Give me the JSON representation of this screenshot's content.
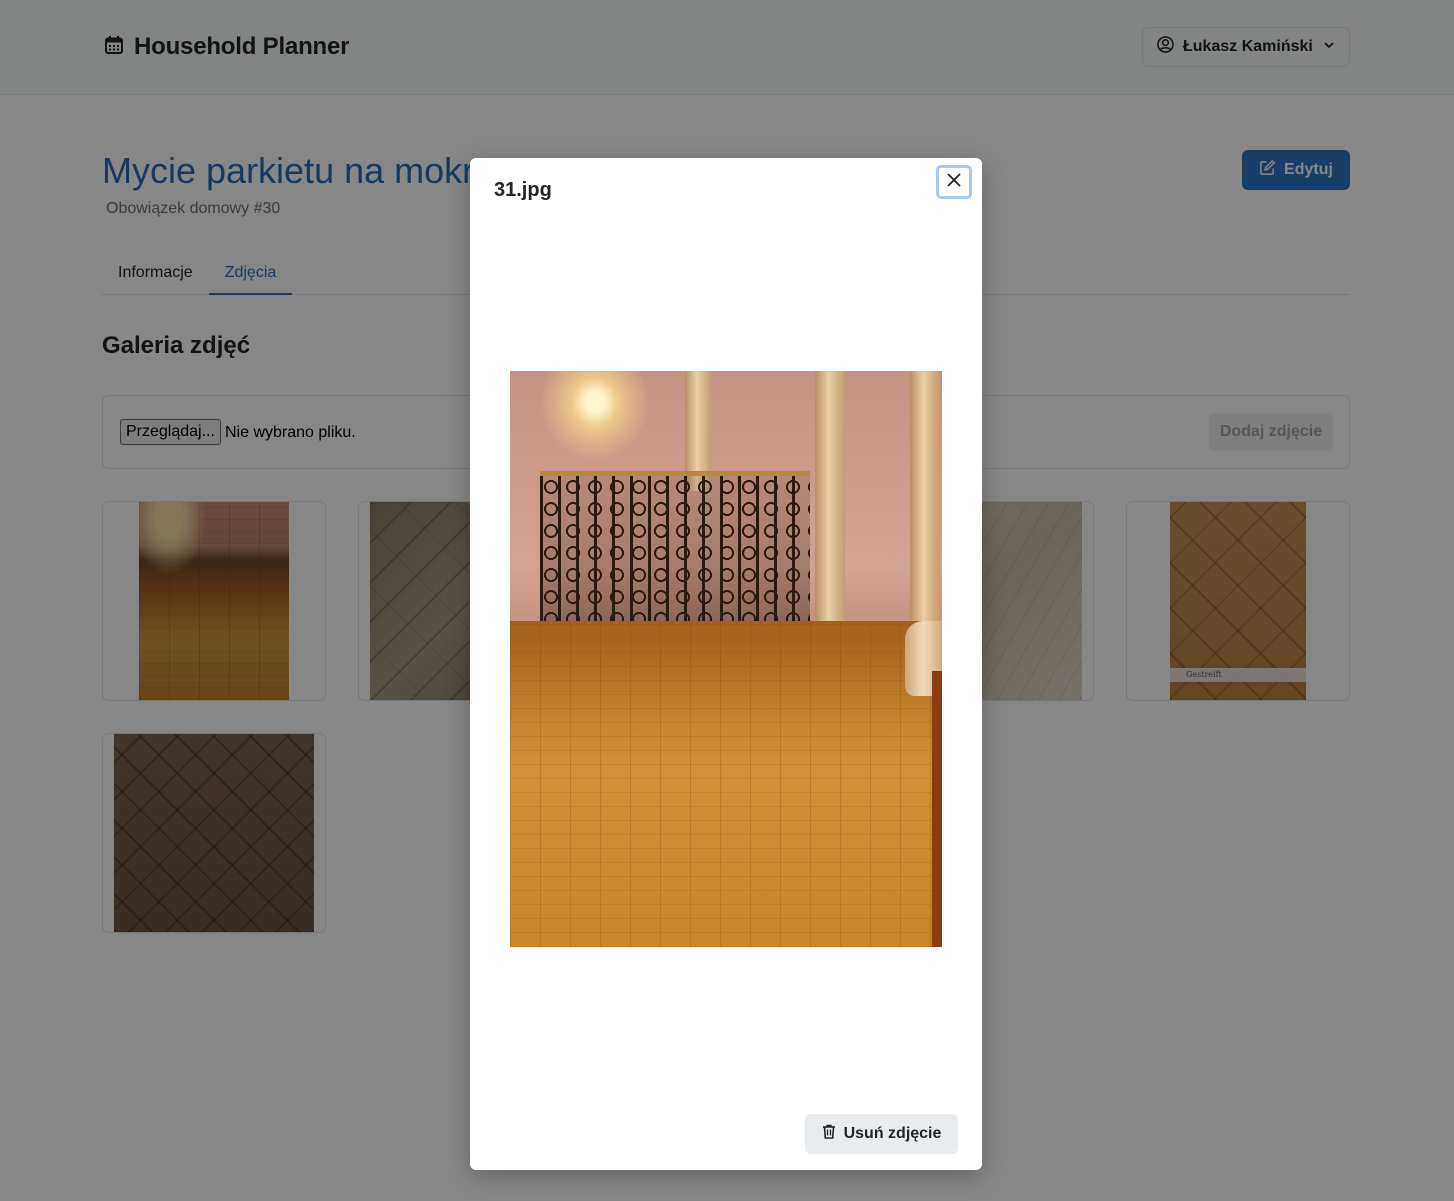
{
  "app": {
    "title": "Household Planner",
    "user_name": "Łukasz Kamiński"
  },
  "page": {
    "title": "Mycie parkietu na mokro",
    "subtitle": "Obowiązek domowy #30",
    "edit_label": "Edytuj"
  },
  "tabs": [
    {
      "label": "Informacje",
      "active": false
    },
    {
      "label": "Zdjęcia",
      "active": true
    }
  ],
  "gallery": {
    "title": "Galeria zdjęć",
    "browse_label": "Przeglądaj...",
    "no_file_text": "Nie wybrano pliku.",
    "add_label": "Dodaj zdjęcie",
    "tile_caption": "Gestreift"
  },
  "modal": {
    "title": "31.jpg",
    "delete_label": "Usuń zdjęcie"
  },
  "colors": {
    "accent": "#2f73c2",
    "title_blue": "#2c6db5",
    "overlay": "rgba(0,0,0,0.47)"
  },
  "icons": {
    "brand": "calendar-icon",
    "user": "user-circle-icon",
    "dropdown": "chevron-down-icon",
    "edit": "pencil-square-icon",
    "close": "close-icon",
    "delete": "trash-icon"
  }
}
